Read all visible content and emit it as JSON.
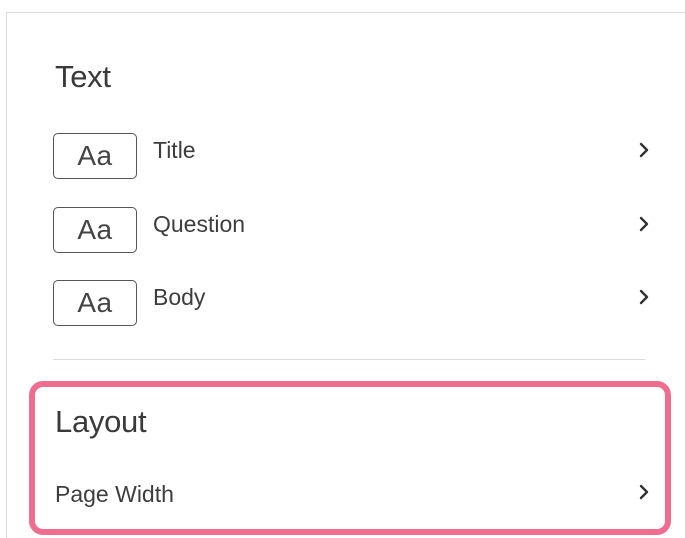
{
  "text_section": {
    "title": "Text",
    "items": [
      {
        "icon_text": "Aa",
        "label": "Title"
      },
      {
        "icon_text": "Aa",
        "label": "Question"
      },
      {
        "icon_text": "Aa",
        "label": "Body"
      }
    ]
  },
  "layout_section": {
    "title": "Layout",
    "items": [
      {
        "label": "Page Width"
      }
    ]
  },
  "colors": {
    "highlight": "#ef6d8f",
    "text": "#3d3d3d",
    "divider": "#dddddd"
  },
  "icons": {
    "row_chevron": "chevron-right-icon"
  }
}
